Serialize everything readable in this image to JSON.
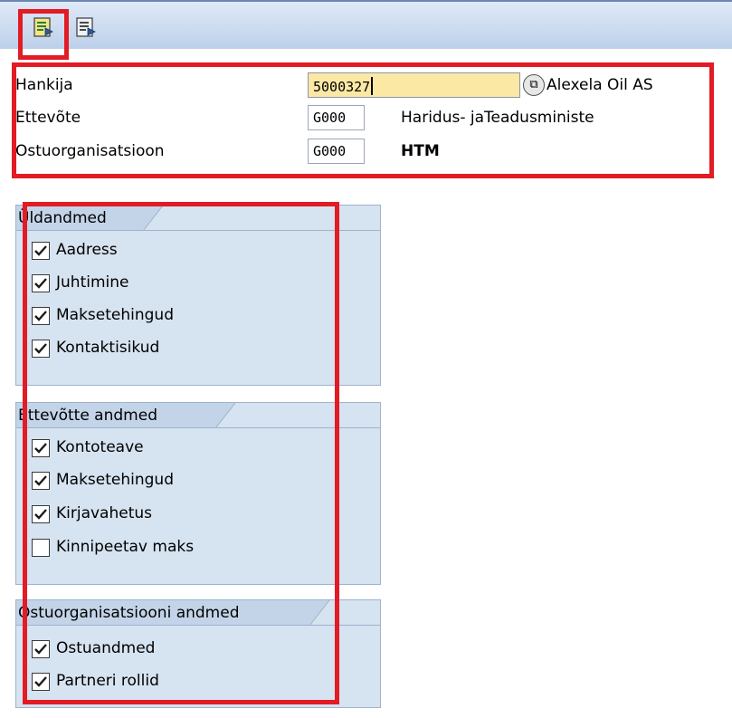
{
  "toolbar": {
    "buttons": [
      {
        "icon": "execute-icon"
      },
      {
        "icon": "layout-icon"
      }
    ]
  },
  "header": {
    "rows": [
      {
        "label": "Hankija",
        "value": "5000327",
        "description": "Alexela Oil AS"
      },
      {
        "label": "Ettevõte",
        "value": "G000",
        "description": "Haridus- jaTeadusministe"
      },
      {
        "label": "Ostuorganisatsioon",
        "value": "G000",
        "description": "HTM"
      }
    ]
  },
  "groups": [
    {
      "title": "Üldandmed",
      "items": [
        {
          "label": "Aadress",
          "checked": true
        },
        {
          "label": "Juhtimine",
          "checked": true
        },
        {
          "label": "Maksetehingud",
          "checked": true
        },
        {
          "label": "Kontaktisikud",
          "checked": true
        }
      ]
    },
    {
      "title": "Ettevõtte andmed",
      "items": [
        {
          "label": "Kontoteave",
          "checked": true
        },
        {
          "label": "Maksetehingud",
          "checked": true
        },
        {
          "label": "Kirjavahetus",
          "checked": true
        },
        {
          "label": "Kinnipeetav maks",
          "checked": false
        }
      ]
    },
    {
      "title": "Ostuorganisatsiooni andmed",
      "items": [
        {
          "label": "Ostuandmed",
          "checked": true
        },
        {
          "label": "Partneri rollid",
          "checked": true
        }
      ]
    }
  ],
  "colors": {
    "highlight": "#e21b24",
    "group_bg": "#d6e3f0",
    "input_focus_bg": "#fbe8a5"
  }
}
